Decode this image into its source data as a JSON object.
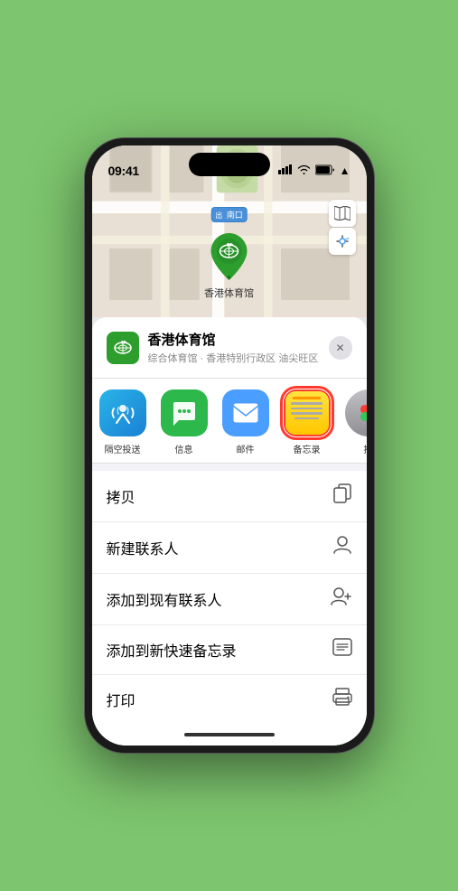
{
  "status_bar": {
    "time": "09:41",
    "signal_icon": "▋▋▋",
    "wifi_icon": "WiFi",
    "battery_icon": "🔋"
  },
  "map": {
    "label": "南口",
    "location_name": "香港体育馆",
    "pin_emoji": "🏟"
  },
  "place_card": {
    "name": "香港体育馆",
    "subtitle": "综合体育馆 · 香港特别行政区 油尖旺区",
    "close_label": "✕"
  },
  "share_items": [
    {
      "id": "airdrop",
      "label": "隔空投送",
      "type": "airdrop"
    },
    {
      "id": "messages",
      "label": "信息",
      "type": "messages"
    },
    {
      "id": "mail",
      "label": "邮件",
      "type": "mail"
    },
    {
      "id": "notes",
      "label": "备忘录",
      "type": "notes",
      "selected": true
    },
    {
      "id": "more",
      "label": "推",
      "type": "more"
    }
  ],
  "actions": [
    {
      "label": "拷贝",
      "icon": "copy"
    },
    {
      "label": "新建联系人",
      "icon": "person"
    },
    {
      "label": "添加到现有联系人",
      "icon": "person-add"
    },
    {
      "label": "添加到新快速备忘录",
      "icon": "note"
    },
    {
      "label": "打印",
      "icon": "printer"
    }
  ]
}
